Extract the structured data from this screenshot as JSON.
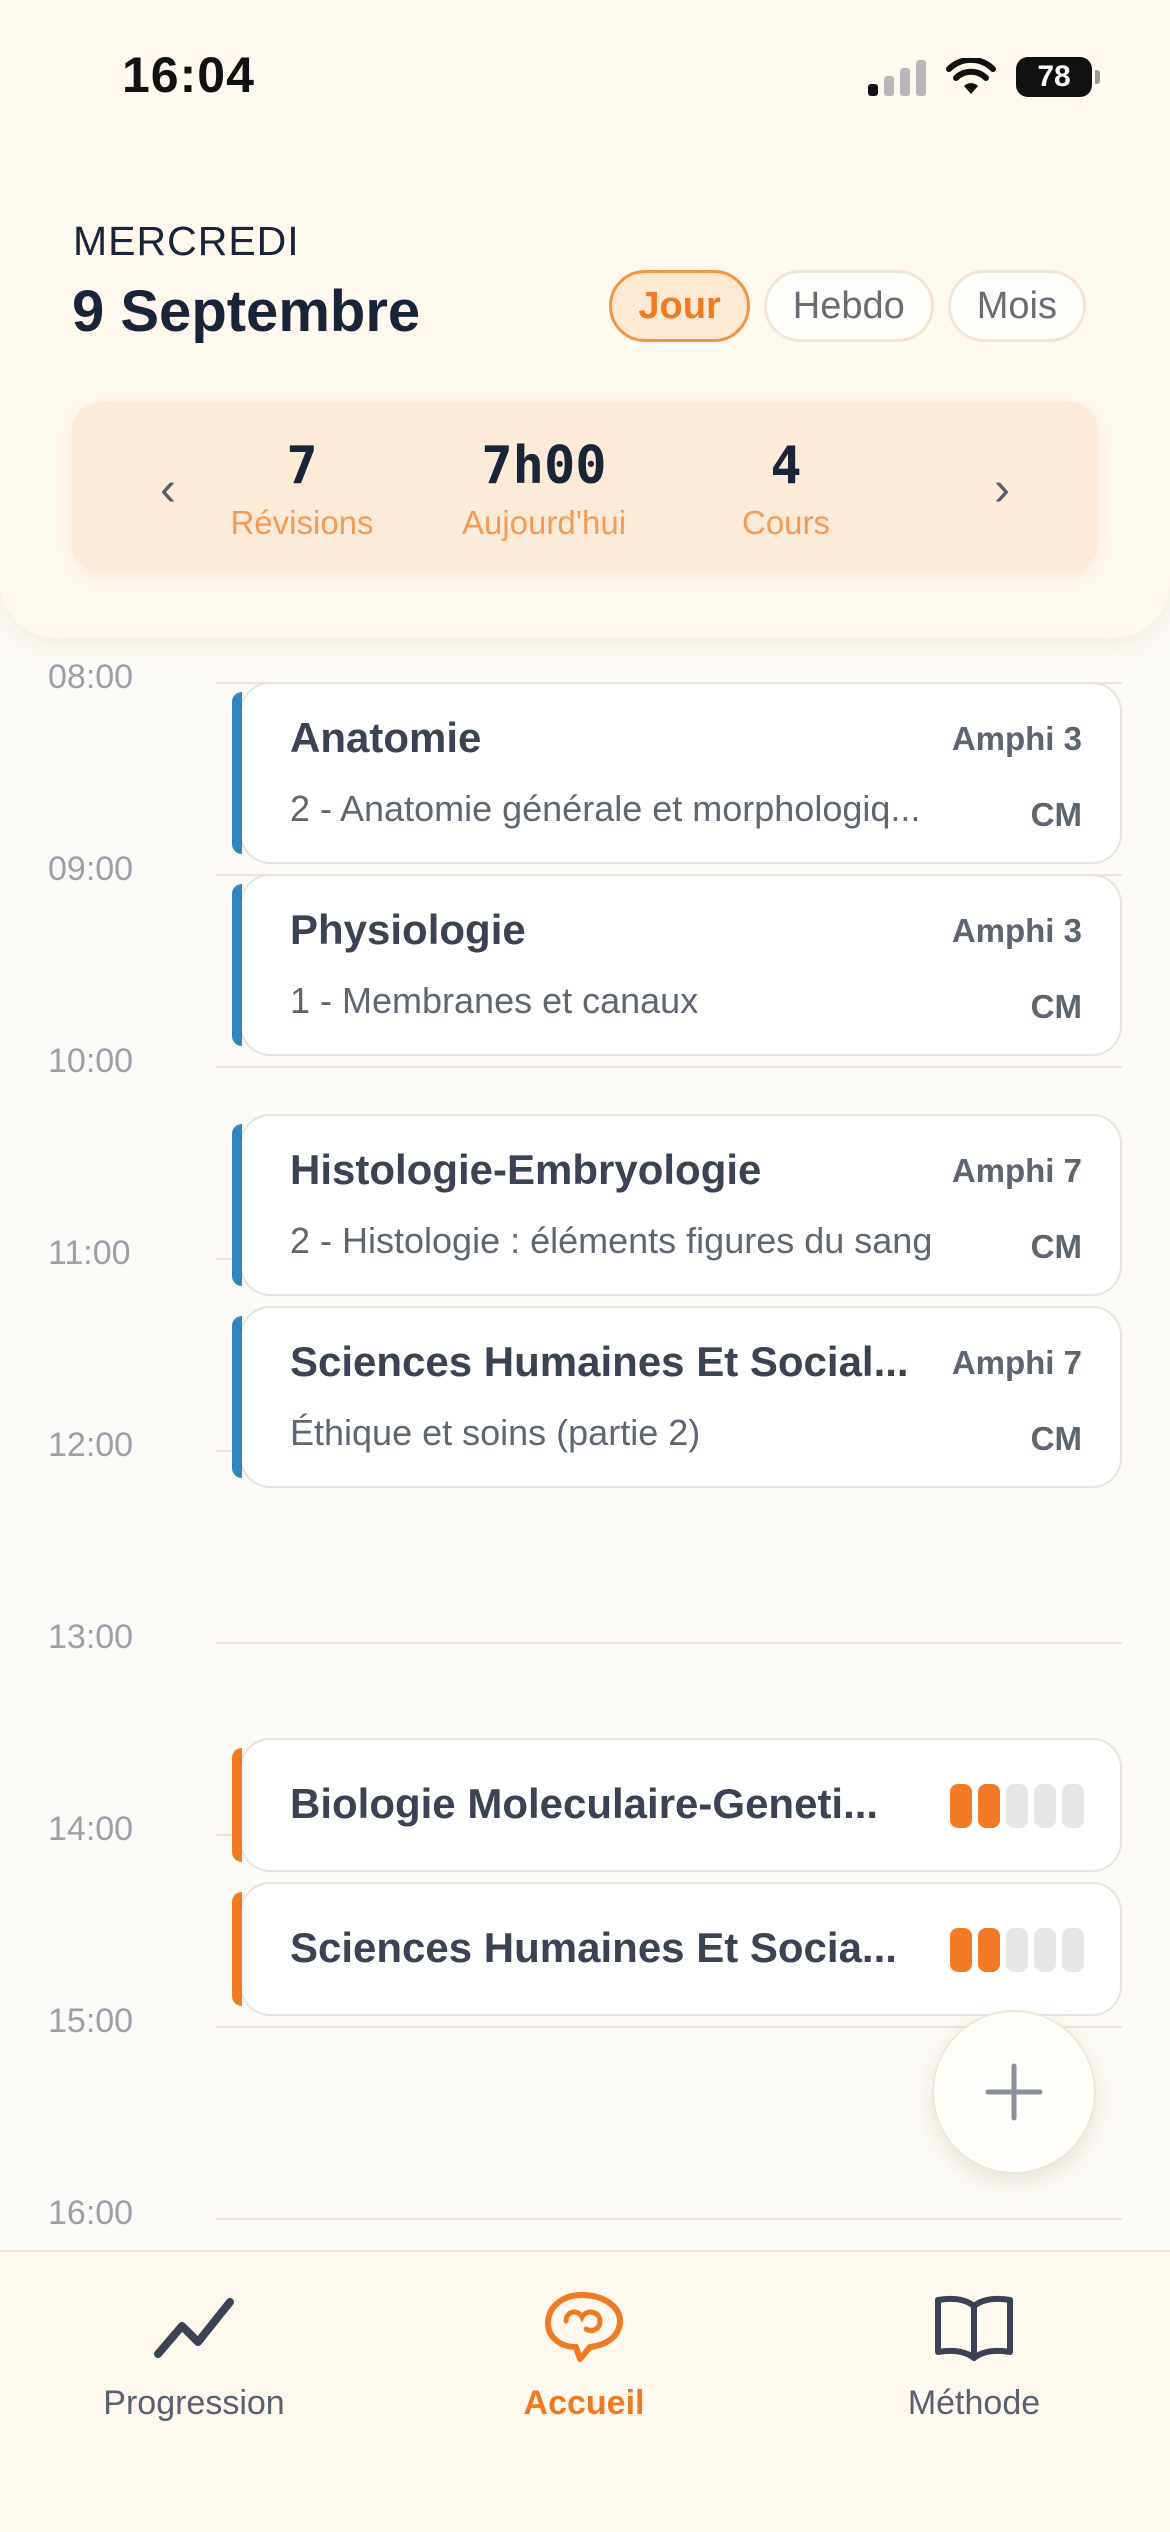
{
  "status_bar": {
    "time": "16:04",
    "battery": "78"
  },
  "header": {
    "day": "MERCREDI",
    "date": "9 Septembre",
    "views": [
      {
        "label": "Jour",
        "active": true
      },
      {
        "label": "Hebdo",
        "active": false
      },
      {
        "label": "Mois",
        "active": false
      }
    ]
  },
  "summary": {
    "revisions": {
      "value": "7",
      "label": "Révisions"
    },
    "today": {
      "value": "7h00",
      "label": "Aujourd'hui"
    },
    "courses": {
      "value": "4",
      "label": "Cours"
    }
  },
  "timeline": {
    "hours": [
      "08:00",
      "09:00",
      "10:00",
      "11:00",
      "12:00",
      "13:00",
      "14:00",
      "15:00",
      "16:00"
    ]
  },
  "courses": [
    {
      "title": "Anatomie",
      "room": "Amphi 3",
      "subtitle": "2 - Anatomie générale et morphologiq...",
      "type": "CM"
    },
    {
      "title": "Physiologie",
      "room": "Amphi 3",
      "subtitle": "1 - Membranes et canaux",
      "type": "CM"
    },
    {
      "title": "Histologie-Embryologie",
      "room": "Amphi 7",
      "subtitle": "2 - Histologie : éléments figures du sang",
      "type": "CM"
    },
    {
      "title": "Sciences Humaines Et Social...",
      "room": "Amphi 7",
      "subtitle": "Éthique et soins (partie 2)",
      "type": "CM"
    }
  ],
  "revisions": [
    {
      "title": "Biologie Moleculaire-Geneti...",
      "progress_level": 2,
      "progress_max": 5
    },
    {
      "title": "Sciences Humaines Et Socia...",
      "progress_level": 2,
      "progress_max": 5
    }
  ],
  "tabbar": {
    "items": [
      {
        "label": "Progression",
        "icon": "trend-chart-icon"
      },
      {
        "label": "Accueil",
        "icon": "brain-bubble-icon",
        "active": true
      },
      {
        "label": "Méthode",
        "icon": "open-book-icon"
      }
    ]
  },
  "colors": {
    "accent": "#F07A22",
    "course_bar": "#2E86C1",
    "revision_bar": "#F27A24"
  }
}
